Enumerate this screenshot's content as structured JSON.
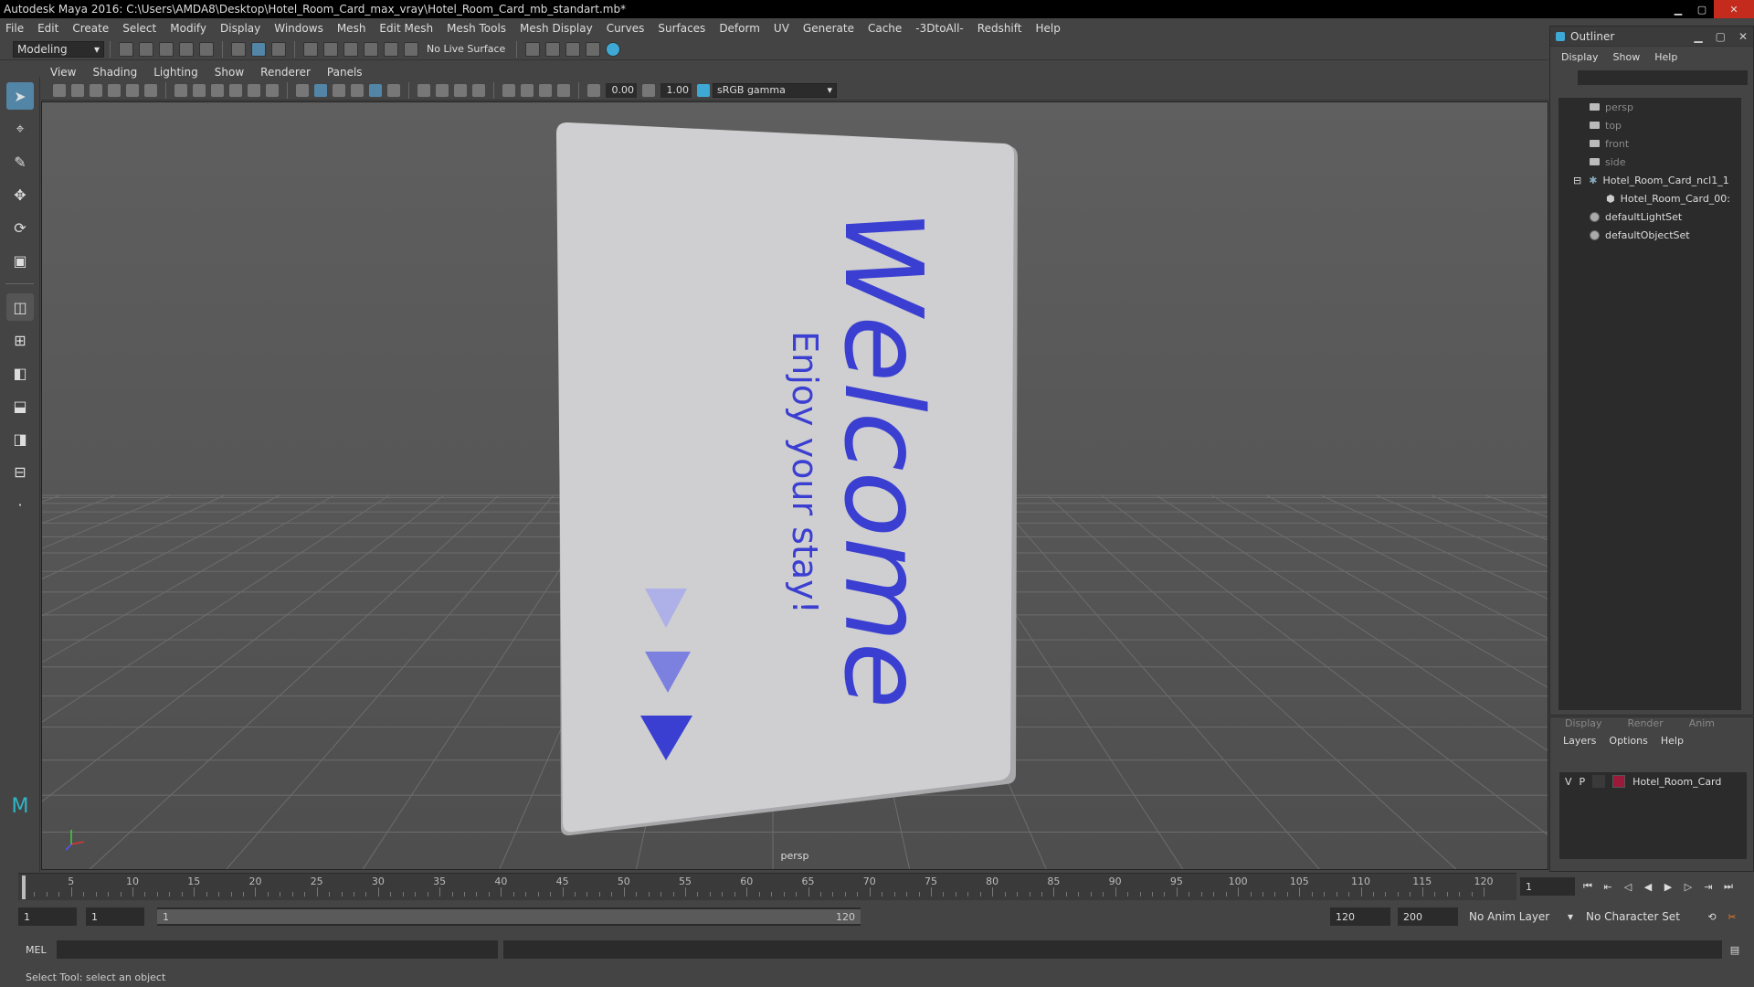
{
  "window": {
    "title": "Autodesk Maya 2016: C:\\Users\\AMDA8\\Desktop\\Hotel_Room_Card_max_vray\\Hotel_Room_Card_mb_standart.mb*",
    "controls": [
      "minimize",
      "maximize",
      "close"
    ]
  },
  "menubar": {
    "items": [
      "File",
      "Edit",
      "Create",
      "Select",
      "Modify",
      "Display",
      "Windows",
      "Mesh",
      "Edit Mesh",
      "Mesh Tools",
      "Mesh Display",
      "Curves",
      "Surfaces",
      "Deform",
      "UV",
      "Generate",
      "Cache",
      "-3DtoAll-",
      "Redshift",
      "Help"
    ]
  },
  "shelf": {
    "mode": "Modeling",
    "live_surface": "No Live Surface"
  },
  "panel": {
    "menus": [
      "View",
      "Shading",
      "Lighting",
      "Show",
      "Renderer",
      "Panels"
    ],
    "exposure": "0.00",
    "gamma": "1.00",
    "color_space": "sRGB gamma",
    "camera_label": "persp"
  },
  "card": {
    "title": "Welcome",
    "subtitle": "Enjoy your stay!",
    "text_color": "#3b3fd1",
    "face_color": "#cfcfd1"
  },
  "outliner": {
    "title": "Outliner",
    "menus": [
      "Display",
      "Show",
      "Help"
    ],
    "items": [
      {
        "label": "persp",
        "type": "camera",
        "dim": true
      },
      {
        "label": "top",
        "type": "camera",
        "dim": true
      },
      {
        "label": "front",
        "type": "camera",
        "dim": true
      },
      {
        "label": "side",
        "type": "camera",
        "dim": true
      },
      {
        "label": "Hotel_Room_Card_ncl1_1",
        "type": "group",
        "dim": false
      },
      {
        "label": "Hotel_Room_Card_00:",
        "type": "mesh",
        "dim": false
      },
      {
        "label": "defaultLightSet",
        "type": "set",
        "dim": false
      },
      {
        "label": "defaultObjectSet",
        "type": "set",
        "dim": false
      }
    ]
  },
  "layers": {
    "tabs": [
      "Display",
      "Render",
      "Anim"
    ],
    "menus": [
      "Layers",
      "Options",
      "Help"
    ],
    "row": {
      "v": "V",
      "p": "P",
      "name": "Hotel_Room_Card",
      "color": "#9b1a3a"
    }
  },
  "timeline": {
    "start": 1,
    "end": 120,
    "ticks": [
      5,
      10,
      15,
      20,
      25,
      30,
      35,
      40,
      45,
      50,
      55,
      60,
      65,
      70,
      75,
      80,
      85,
      90,
      95,
      100,
      105,
      110,
      115,
      120
    ],
    "current_frame": "1"
  },
  "range": {
    "start_min": "1",
    "start": "1",
    "slider_start": "1",
    "slider_end": "120",
    "end": "120",
    "end_max": "200",
    "anim_layer": "No Anim Layer",
    "char_set": "No Character Set"
  },
  "command": {
    "label": "MEL"
  },
  "help": {
    "text": "Select Tool: select an object"
  }
}
